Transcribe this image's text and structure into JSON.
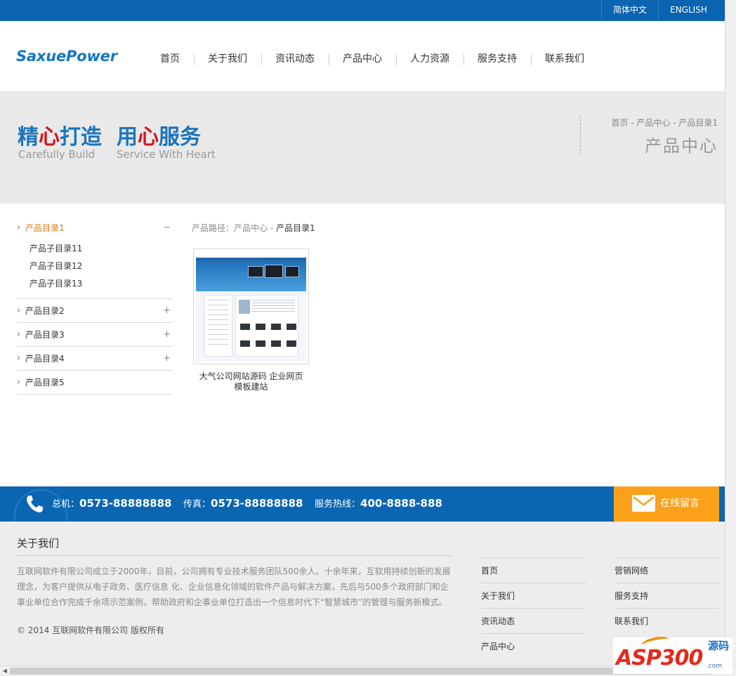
{
  "lang": {
    "cn": "简体中文",
    "en": "ENGLISH"
  },
  "logo": "SaxuePower",
  "nav": [
    "首页",
    "关于我们",
    "资讯动态",
    "产品中心",
    "人力资源",
    "服务支持",
    "联系我们"
  ],
  "banner": {
    "slogan_a": {
      "pre": "精",
      "red": "心",
      "post": "打造"
    },
    "slogan_b": {
      "pre": "用",
      "red": "心",
      "post": "服务"
    },
    "slogan_a_en": "Carefully Build",
    "slogan_b_en": "Service With Heart",
    "breadcrumb": "首页 - 产品中心 - 产品目录1",
    "title": "产品中心"
  },
  "sidebar": {
    "active": {
      "label": "产品目录1",
      "toggle": "−",
      "children": [
        "产品子目录11",
        "产品子目录12",
        "产品子目录13"
      ]
    },
    "others": [
      {
        "label": "产品目录2",
        "toggle": "+"
      },
      {
        "label": "产品目录3",
        "toggle": "+"
      },
      {
        "label": "产品目录4",
        "toggle": "+"
      },
      {
        "label": "产品目录5",
        "toggle": ""
      }
    ]
  },
  "path": {
    "prefix": "产品路径：产品中心 - ",
    "current": "产品目录1"
  },
  "product": {
    "caption_1": "大气公司网站源码 企业网页",
    "caption_2": "模板建站"
  },
  "contact": {
    "c1_label": "总机：",
    "c1_value": "0573-88888888",
    "c2_label": "传真：",
    "c2_value": "0573-88888888",
    "c3_label": "服务热线：",
    "c3_value": "400-8888-888",
    "message_button": "在线留言"
  },
  "footer": {
    "title": "关于我们",
    "text": "互联网软件有限公司成立于2000年，目前，公司拥有专业技术服务团队500余人。十余年来，互软用持续创新的发展理念，为客户提供从电子政务、医疗信息 化、企业信息化领域的软件产品与解决方案，先后与500多个政府部门和企事业单位合作完成千余项示范案例，帮助政府和企事业单位打造出一个信息时代下“智慧城市”的管理与服务新模式。",
    "copyright": "© 2014 互联网软件有限公司 版权所有",
    "links_col1": [
      "首页",
      "关于我们",
      "资讯动态",
      "产品中心"
    ],
    "links_col2": [
      "营销网络",
      "服务支持",
      "联系我们"
    ]
  },
  "watermark": {
    "brand": "ASP300",
    "tag": "源码",
    "domain": ".com"
  },
  "colors": {
    "primary_blue": "#0a64b0",
    "accent_red": "#d4161d",
    "active_orange": "#d4771a",
    "message_orange": "#fba019"
  }
}
